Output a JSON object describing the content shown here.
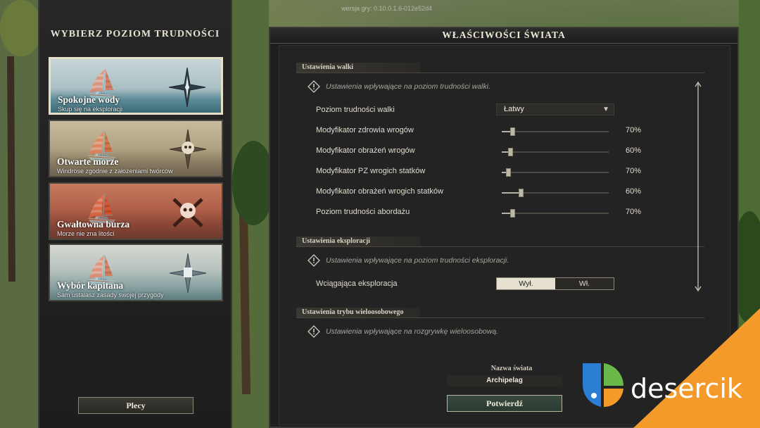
{
  "version": "wersja gry: 0.10.0.1.6-012e52d4",
  "left": {
    "title": "WYBIERZ POZIOM TRUDNOŚCI",
    "options": [
      {
        "name": "Spokojne wody",
        "desc": "Skup się na eksploracji",
        "selected": true,
        "emblem": "compass-star-icon"
      },
      {
        "name": "Otwarte morze",
        "desc": "Windrose zgodnie z założeniami twórców",
        "selected": false,
        "emblem": "skull-compass-icon"
      },
      {
        "name": "Gwałtowna burza",
        "desc": "Morze nie zna litości",
        "selected": false,
        "emblem": "skull-crossbones-icon"
      },
      {
        "name": "Wybór kapitana",
        "desc": "Sam ustalasz zasady swojej przygody",
        "selected": false,
        "emblem": "custom-compass-icon"
      }
    ],
    "back_label": "Plecy"
  },
  "right": {
    "title": "WŁAŚCIWOŚCI ŚWIATA",
    "combat": {
      "header": "Ustawienia walki",
      "note": "Ustawienia wpływające na poziom trudności walki.",
      "difficulty_label": "Poziom trudności walki",
      "difficulty_value": "Łatwy",
      "sliders": [
        {
          "label": "Modyfikator zdrowia wrogów",
          "value": "70%",
          "fraction": 0.1
        },
        {
          "label": "Modyfikator obrażeń wrogów",
          "value": "60%",
          "fraction": 0.08
        },
        {
          "label": "Modyfikator PZ wrogich statków",
          "value": "70%",
          "fraction": 0.06
        },
        {
          "label": "Modyfikator obrażeń wrogich statków",
          "value": "60%",
          "fraction": 0.18
        },
        {
          "label": "Poziom trudności abordażu",
          "value": "70%",
          "fraction": 0.1
        }
      ]
    },
    "exploration": {
      "header": "Ustawienia eksploracji",
      "note": "Ustawienia wpływające na poziom trudności eksploracji.",
      "immersive_label": "Wciągająca eksploracja",
      "toggle_off": "Wył.",
      "toggle_on": "Wł."
    },
    "multiplayer": {
      "header": "Ustawienia trybu wieloosobowego",
      "note": "Ustawienia wpływające na rozgrywkę wieloosobową.",
      "world_name_label": "Nazwa świata",
      "world_name_value": "Archipelag"
    },
    "confirm_label": "Potwierdź"
  },
  "watermark": {
    "text": "desercik",
    "accent": "#f39a2a"
  }
}
